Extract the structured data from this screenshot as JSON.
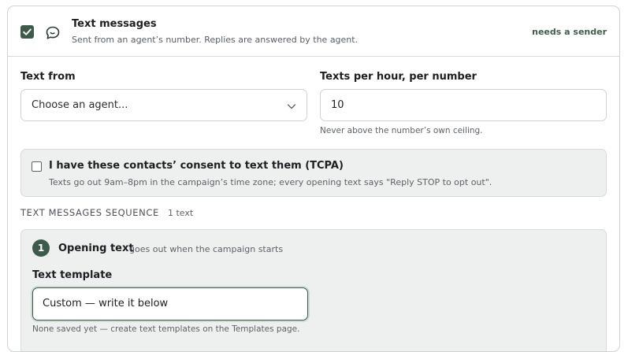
{
  "channel": {
    "enabled": true,
    "icon": "chat-bubble-icon",
    "title": "Text messages",
    "subtitle": "Sent from an agent’s number. Replies are answered by the agent.",
    "status": "needs a sender"
  },
  "text_from": {
    "label": "Text from",
    "value": "Choose an agent...",
    "icon": "chevron-down-icon"
  },
  "rate": {
    "label": "Texts per hour, per number",
    "value": "10",
    "hint": "Never above the number’s own ceiling."
  },
  "consent": {
    "checked": false,
    "title": "I have these contacts’ consent to text them (TCPA)",
    "subtitle": "Texts go out 9am–8pm in the campaign’s time zone; every opening text says \"Reply STOP to opt out\"."
  },
  "sequence": {
    "heading": "TEXT MESSAGES SEQUENCE",
    "count": "1 text",
    "steps": [
      {
        "number": "1",
        "title": "Opening text",
        "when": "goes out when the campaign starts",
        "template_label": "Text template",
        "template_value": "Custom — write it below",
        "template_hint": "None saved yet — create text templates on the Templates page."
      }
    ]
  },
  "colors": {
    "accent": "#3d5a4b",
    "panel_bg": "#eef0ef",
    "border": "#cfd3d1"
  }
}
